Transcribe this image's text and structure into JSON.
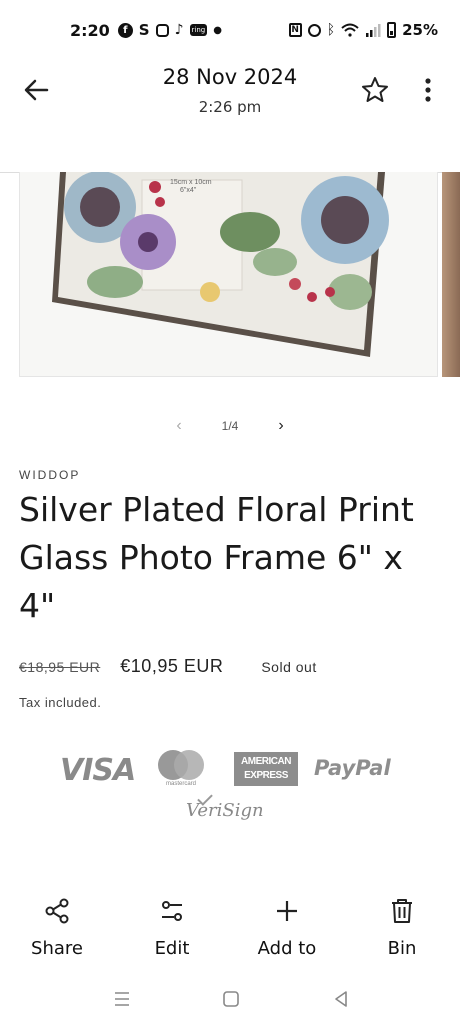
{
  "status": {
    "time": "2:20",
    "battery": "25%"
  },
  "header": {
    "date": "28 Nov 2024",
    "time": "2:26 pm"
  },
  "gallery": {
    "pager_text": "1/4",
    "frame_label_1": "15cm x 10cm",
    "frame_label_2": "6\"x4\""
  },
  "product": {
    "vendor": "WIDDOP",
    "title": "Silver Plated Floral Print Glass Photo Frame 6\" x 4\"",
    "price_old": "€18,95 EUR",
    "price_new": "€10,95 EUR",
    "availability": "Sold out",
    "tax_note": "Tax included."
  },
  "payments": {
    "visa": "VISA",
    "mastercard": "mastercard",
    "amex_line1": "AMERICAN",
    "amex_line2": "EXPRESS",
    "paypal": "PayPal",
    "verisign": "VeriSign"
  },
  "actions": [
    {
      "label": "Share",
      "icon": "share-icon"
    },
    {
      "label": "Edit",
      "icon": "edit-icon"
    },
    {
      "label": "Add to",
      "icon": "plus-icon"
    },
    {
      "label": "Bin",
      "icon": "trash-icon"
    }
  ],
  "colors": {
    "logo_gray": "#8a8a8a",
    "text": "#111111"
  }
}
